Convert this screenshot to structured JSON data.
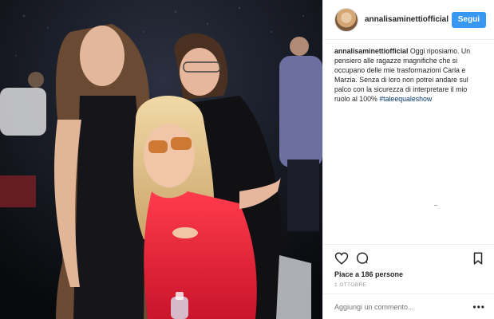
{
  "post": {
    "photo_alt": "photo",
    "header": {
      "username": "annalisaminettiofficial",
      "follow_label": "Segui"
    },
    "caption": {
      "username": "annalisaminettiofficial",
      "text": " Oggi riposiamo. Un pensiero alle ragazze magnifiche che si occupano delle mie trasformazioni Carla e Marzia. Senza di loro non potrei andare sul palco con la sicurezza di interpretare il mio ruolo al 100% ",
      "hashtag": "#taleequaleshow"
    },
    "actions": {
      "like_icon": "heart-icon",
      "comment_icon": "comment-icon",
      "save_icon": "bookmark-icon"
    },
    "likes_text": "Piace a 186 persone",
    "date_text": "1 OTTOBRE",
    "comment": {
      "placeholder": "Aggiungi un commento...",
      "more_label": "•••"
    },
    "colors": {
      "follow_button": "#3897f0",
      "hashtag": "#003569",
      "muted_text": "#999999"
    }
  }
}
